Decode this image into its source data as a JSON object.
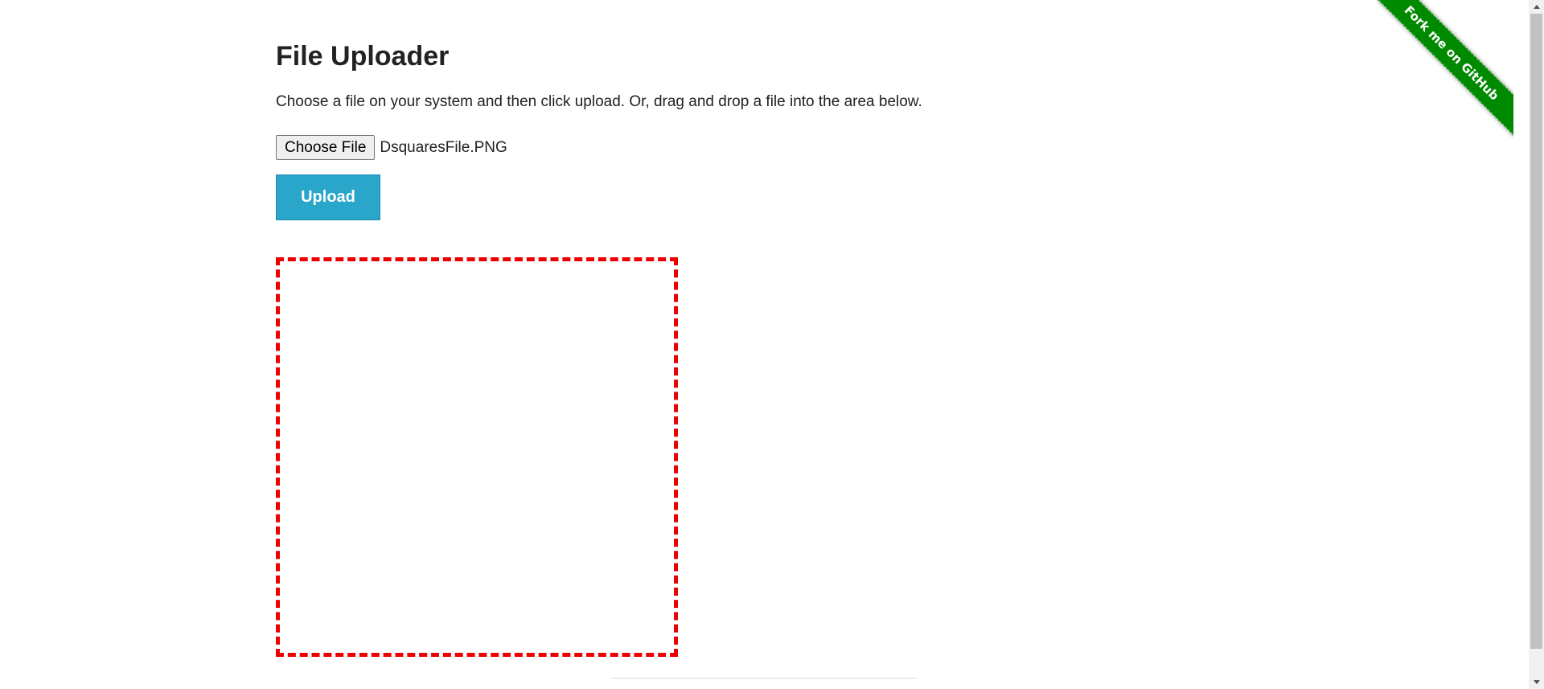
{
  "page": {
    "title": "File Uploader",
    "description": "Choose a file on your system and then click upload. Or, drag and drop a file into the area below."
  },
  "file_input": {
    "button_label": "Choose File",
    "selected_file": "DsquaresFile.PNG"
  },
  "upload_button": {
    "label": "Upload",
    "color": "#2ba6cb"
  },
  "drop_zone": {
    "border_color": "#ee0000"
  },
  "github_ribbon": {
    "label": "Fork me on GitHub",
    "color": "#008a00"
  }
}
